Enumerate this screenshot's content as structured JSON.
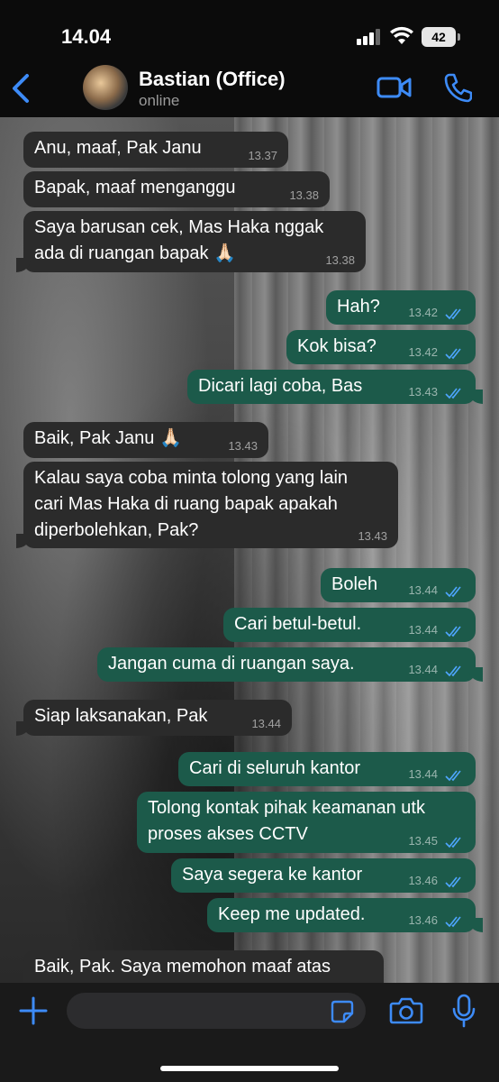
{
  "status_bar": {
    "time": "14.04",
    "battery": "42"
  },
  "header": {
    "contact_name": "Bastian (Office)",
    "contact_status": "online"
  },
  "colors": {
    "accent": "#3d8bf7",
    "incoming_bubble": "#2b2b2b",
    "outgoing_bubble": "#1c5a4a",
    "read_ticks": "#4ea6ff"
  },
  "messages": [
    {
      "direction": "in",
      "text": "Anu, maaf, Pak Janu",
      "time": "13.37"
    },
    {
      "direction": "in",
      "text": "Bapak, maaf menganggu",
      "time": "13.38"
    },
    {
      "direction": "in",
      "text": "Saya barusan cek, Mas Haka nggak\nada di ruangan bapak 🙏🏻",
      "time": "13.38"
    },
    {
      "direction": "out",
      "text": "Hah?",
      "time": "13.42"
    },
    {
      "direction": "out",
      "text": "Kok bisa?",
      "time": "13.42"
    },
    {
      "direction": "out",
      "text": "Dicari lagi coba, Bas",
      "time": "13.43"
    },
    {
      "direction": "in",
      "text": "Baik, Pak Janu 🙏🏻",
      "time": "13.43"
    },
    {
      "direction": "in",
      "text": "Kalau saya coba minta tolong yang lain\ncari Mas Haka di ruang bapak apakah\ndiperbolehkan, Pak?",
      "time": "13.43"
    },
    {
      "direction": "out",
      "text": "Boleh",
      "time": "13.44"
    },
    {
      "direction": "out",
      "text": "Cari betul-betul.",
      "time": "13.44"
    },
    {
      "direction": "out",
      "text": "Jangan cuma di ruangan saya.",
      "time": "13.44"
    },
    {
      "direction": "in",
      "text": "Siap laksanakan, Pak",
      "time": "13.44"
    },
    {
      "direction": "out",
      "text": "Cari di seluruh kantor",
      "time": "13.44"
    },
    {
      "direction": "out",
      "text": "Tolong kontak pihak keamanan utk\nproses akses CCTV",
      "time": "13.45"
    },
    {
      "direction": "out",
      "text": "Saya segera ke kantor",
      "time": "13.46"
    },
    {
      "direction": "out",
      "text": "Keep me updated.",
      "time": "13.46"
    },
    {
      "direction": "in",
      "text": "Baik, Pak. Saya memohon maaf atas",
      "time": ""
    }
  ],
  "composer": {
    "placeholder": ""
  },
  "icons": {
    "back": "chevron-left-icon",
    "video": "video-camera-icon",
    "call": "phone-icon",
    "add": "plus-icon",
    "sticker": "sticker-icon",
    "camera": "camera-icon",
    "mic": "microphone-icon"
  }
}
